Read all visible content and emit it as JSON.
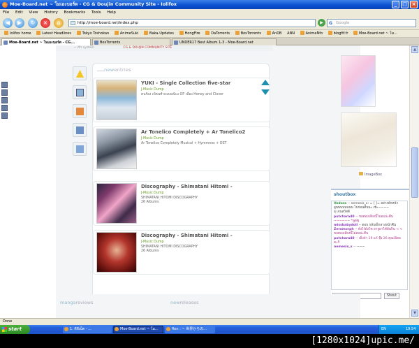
{
  "window": {
    "title": "Moe-Board.net ~ โมเอะบอร์ด - CG & Doujin Community Site - Iolifox",
    "minimize": "_",
    "maximize": "□",
    "close": "×"
  },
  "menu": [
    "File",
    "Edit",
    "View",
    "History",
    "Bookmarks",
    "Tools",
    "Help"
  ],
  "nav": {
    "url": "http://moe-board.net/index.php",
    "search_placeholder": "Google",
    "search_glyph": "G"
  },
  "bookmarks": [
    "lolifox home",
    "Latest Headlines",
    "Tokyo Toshokan",
    "AnimeSuki",
    "Baka-Updates",
    "HongFire",
    "DaTorrents",
    "BoxTorrents",
    "AnDB",
    "ANN",
    "AnimeNfo",
    "blogfif.fr",
    "Moe-Board.net ~ โม..."
  ],
  "tabs": [
    "Moe-Board.net ~ โมเอะบอร์ด - CG...",
    "BoxTorrents",
    "UNDER17 Best Album 1-3 - Moe-Board.net"
  ],
  "page": {
    "topnav_left": "» เข้า system",
    "topnav_right": "CG & DOUJIN COMMUNITY SITE",
    "newentries_label_a": "new",
    "newentries_label_b": "entries",
    "entries": [
      {
        "title": "YUKI - Single Collection five-star",
        "category": "J-Music Dump",
        "desc": "คนร้อง เพ้คนทำเพลงอนิเม OP เพื่อง Honey and Clover"
      },
      {
        "title": "Ar Tonelico Completely + Ar Tonelico2",
        "category": "J-Music Dump",
        "desc": "Ar Tonelico Completely Musical + Hymmnos + OST"
      },
      {
        "title": "Discography - Shimatani Hitomi -",
        "category": "J-Music Dump",
        "desc": "SHIMATANI HITOMI DISCOGRAPHY\n26 Albums"
      },
      {
        "title": "Discography - Shimatani Hitomi -",
        "category": "J-Music Dump",
        "desc": "SHIMATANI HITOMI DISCOGRAPHY\n26 Albums"
      }
    ],
    "neko_navi": "neko navi",
    "imagebox": "ImageBox",
    "shoutbox_title": "shoutbox",
    "shouts": [
      {
        "name": "Vedora",
        "text": "-- nemesis_x: = [ ]= อย่างพักหน้าผูนนนนนนนน ไปก่อนคืนนะ เข้ะ~~~~"
      },
      {
        "name": "",
        "text": "อุ เจนสวัสดี"
      },
      {
        "name": "putchara40",
        "text": "-- ขอต่องเสียงนี้ไม่อบน่ะคืน ~~~~~~ *พูดซู"
      },
      {
        "name": "missbabydoll",
        "text": "-- ตอบ กลับเพ็กลางหน้าคืน"
      },
      {
        "name": "Zeromorph",
        "text": "-- ทั่งไว้ผังโซ อาจูยาไห้พันกิน < < ขอต่องเสียงนี้ไม่อบน่ะคืน"
      },
      {
        "name": "putchara40",
        "text": "-- เพิ่งถ้า 19 แก้ จุ๊ย 26 คุณเปิดอคะกิ"
      },
      {
        "name": "nemesis_x",
        "text": "-- ~~~"
      }
    ],
    "shout_button": "Shout",
    "mangareviews_a": "manga",
    "mangareviews_b": "reviews",
    "newreleases_a": "new",
    "newreleases_b": "releases"
  },
  "status": "Done",
  "taskbar": {
    "start": "start",
    "items": [
      "1. ดีดีเน็ต - ...",
      "Moe-Board.net ~ โม...",
      "Ren : ~ 世界からの..."
    ],
    "lang": "EN",
    "clock": "19:54"
  },
  "watermark": "[1280x1024]upic.me/"
}
